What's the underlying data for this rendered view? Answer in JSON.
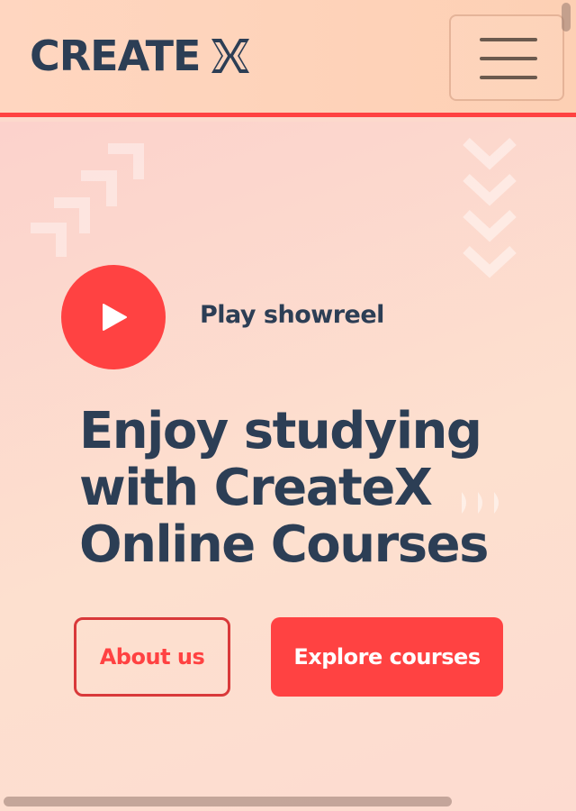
{
  "header": {
    "logo_text": "CREATE",
    "logo_mark_icon": "createx-x-logo-icon",
    "menu_icon": "hamburger-menu-icon"
  },
  "hero": {
    "play_icon": "play-icon",
    "play_label": "Play showreel",
    "title_lines": [
      "Enjoy studying",
      "with CreateX",
      "Online Courses"
    ],
    "about_button": "About us",
    "explore_button": "Explore courses"
  },
  "colors": {
    "accent": "#ff4242",
    "text_dark": "#2c3e55",
    "header_bg": "#fdd0b4",
    "hero_bg": "#fcd9cc"
  }
}
